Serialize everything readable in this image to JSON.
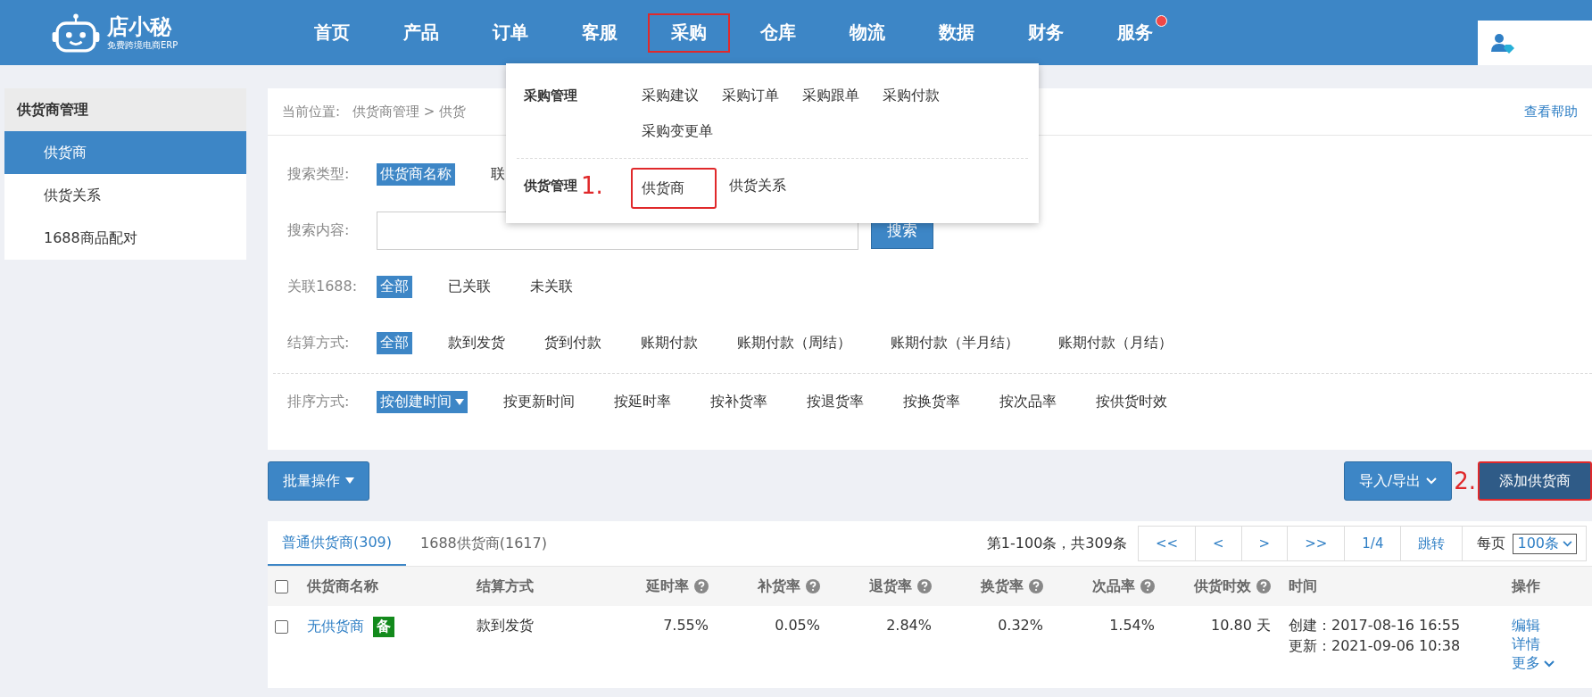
{
  "header": {
    "logo": {
      "name": "店小秘",
      "tagline": "免费跨境电商ERP"
    },
    "nav": [
      {
        "label": "首页",
        "highlighted": false,
        "badge": false
      },
      {
        "label": "产品",
        "highlighted": false,
        "badge": false
      },
      {
        "label": "订单",
        "highlighted": false,
        "badge": false
      },
      {
        "label": "客服",
        "highlighted": false,
        "badge": false
      },
      {
        "label": "采购",
        "highlighted": true,
        "badge": false
      },
      {
        "label": "仓库",
        "highlighted": false,
        "badge": false
      },
      {
        "label": "物流",
        "highlighted": false,
        "badge": false
      },
      {
        "label": "数据",
        "highlighted": false,
        "badge": false
      },
      {
        "label": "财务",
        "highlighted": false,
        "badge": false
      },
      {
        "label": "服务",
        "highlighted": false,
        "badge": true
      }
    ]
  },
  "purchase_menu": {
    "groups": [
      {
        "title": "采购管理",
        "items": [
          {
            "label": "采购建议",
            "highlighted": false
          },
          {
            "label": "采购订单",
            "highlighted": false
          },
          {
            "label": "采购跟单",
            "highlighted": false
          },
          {
            "label": "采购付款",
            "highlighted": false
          },
          {
            "label": "采购变更单",
            "highlighted": false
          }
        ]
      },
      {
        "title": "供货管理",
        "marker": "1.",
        "items": [
          {
            "label": "供货商",
            "highlighted": true
          },
          {
            "label": "供货关系",
            "highlighted": false
          }
        ]
      }
    ]
  },
  "sidebar": {
    "title": "供货商管理",
    "items": [
      {
        "label": "供货商",
        "selected": true
      },
      {
        "label": "供货关系",
        "selected": false
      },
      {
        "label": "1688商品配对",
        "selected": false
      }
    ]
  },
  "breadcrumb": {
    "label": "当前位置:",
    "path": "供货商管理 > 供货",
    "help": "查看帮助"
  },
  "search_type": {
    "label": "搜索类型:",
    "options": [
      {
        "label": "供货商名称",
        "selected": true
      },
      {
        "label": "联",
        "selected": false
      }
    ]
  },
  "search_content": {
    "label": "搜索内容:",
    "button": "搜索"
  },
  "filters": [
    {
      "label": "关联1688:",
      "options": [
        {
          "label": "全部",
          "selected": true
        },
        {
          "label": "已关联",
          "selected": false
        },
        {
          "label": "未关联",
          "selected": false
        }
      ]
    },
    {
      "label": "结算方式:",
      "options": [
        {
          "label": "全部",
          "selected": true
        },
        {
          "label": "款到发货",
          "selected": false
        },
        {
          "label": "货到付款",
          "selected": false
        },
        {
          "label": "账期付款",
          "selected": false
        },
        {
          "label": "账期付款（周结）",
          "selected": false
        },
        {
          "label": "账期付款（半月结）",
          "selected": false
        },
        {
          "label": "账期付款（月结）",
          "selected": false
        }
      ]
    }
  ],
  "sort": {
    "label": "排序方式:",
    "options": [
      {
        "label": "按创建时间",
        "selected": true
      },
      {
        "label": "按更新时间",
        "selected": false
      },
      {
        "label": "按延时率",
        "selected": false
      },
      {
        "label": "按补货率",
        "selected": false
      },
      {
        "label": "按退货率",
        "selected": false
      },
      {
        "label": "按换货率",
        "selected": false
      },
      {
        "label": "按次品率",
        "selected": false
      },
      {
        "label": "按供货时效",
        "selected": false
      }
    ]
  },
  "toolbar": {
    "batch": "批量操作",
    "import_export": "导入/导出",
    "marker": "2.",
    "add": {
      "label": "添加供货商",
      "highlighted": true
    }
  },
  "tabs": [
    {
      "label": "普通供货商(309)",
      "selected": true
    },
    {
      "label": "1688供货商(1617)",
      "selected": false
    }
  ],
  "pagination": {
    "summary": "第1-100条，共309条",
    "buttons": [
      "<<",
      "<",
      ">",
      ">>",
      "1/4",
      "跳转"
    ],
    "per_page_label": "每页",
    "per_page": "100条"
  },
  "table": {
    "select_all_checked": false,
    "columns": [
      {
        "label": "供货商名称",
        "help": false
      },
      {
        "label": "结算方式",
        "help": false
      },
      {
        "label": "延时率",
        "help": true
      },
      {
        "label": "补货率",
        "help": true
      },
      {
        "label": "退货率",
        "help": true
      },
      {
        "label": "换货率",
        "help": true
      },
      {
        "label": "次品率",
        "help": true
      },
      {
        "label": "供货时效",
        "help": true
      },
      {
        "label": "时间",
        "help": false
      },
      {
        "label": "操作",
        "help": false
      }
    ],
    "rows": [
      {
        "checked": false,
        "name": "无供货商",
        "tag": "备",
        "settlement": "款到发货",
        "rates": [
          "7.55%",
          "0.05%",
          "2.84%",
          "0.32%",
          "1.54%",
          "10.80 天"
        ],
        "created": "创建：2017-08-16 16:55",
        "updated": "更新：2021-09-06 10:38",
        "actions": [
          "编辑",
          "详情"
        ],
        "more": "更多"
      }
    ]
  }
}
